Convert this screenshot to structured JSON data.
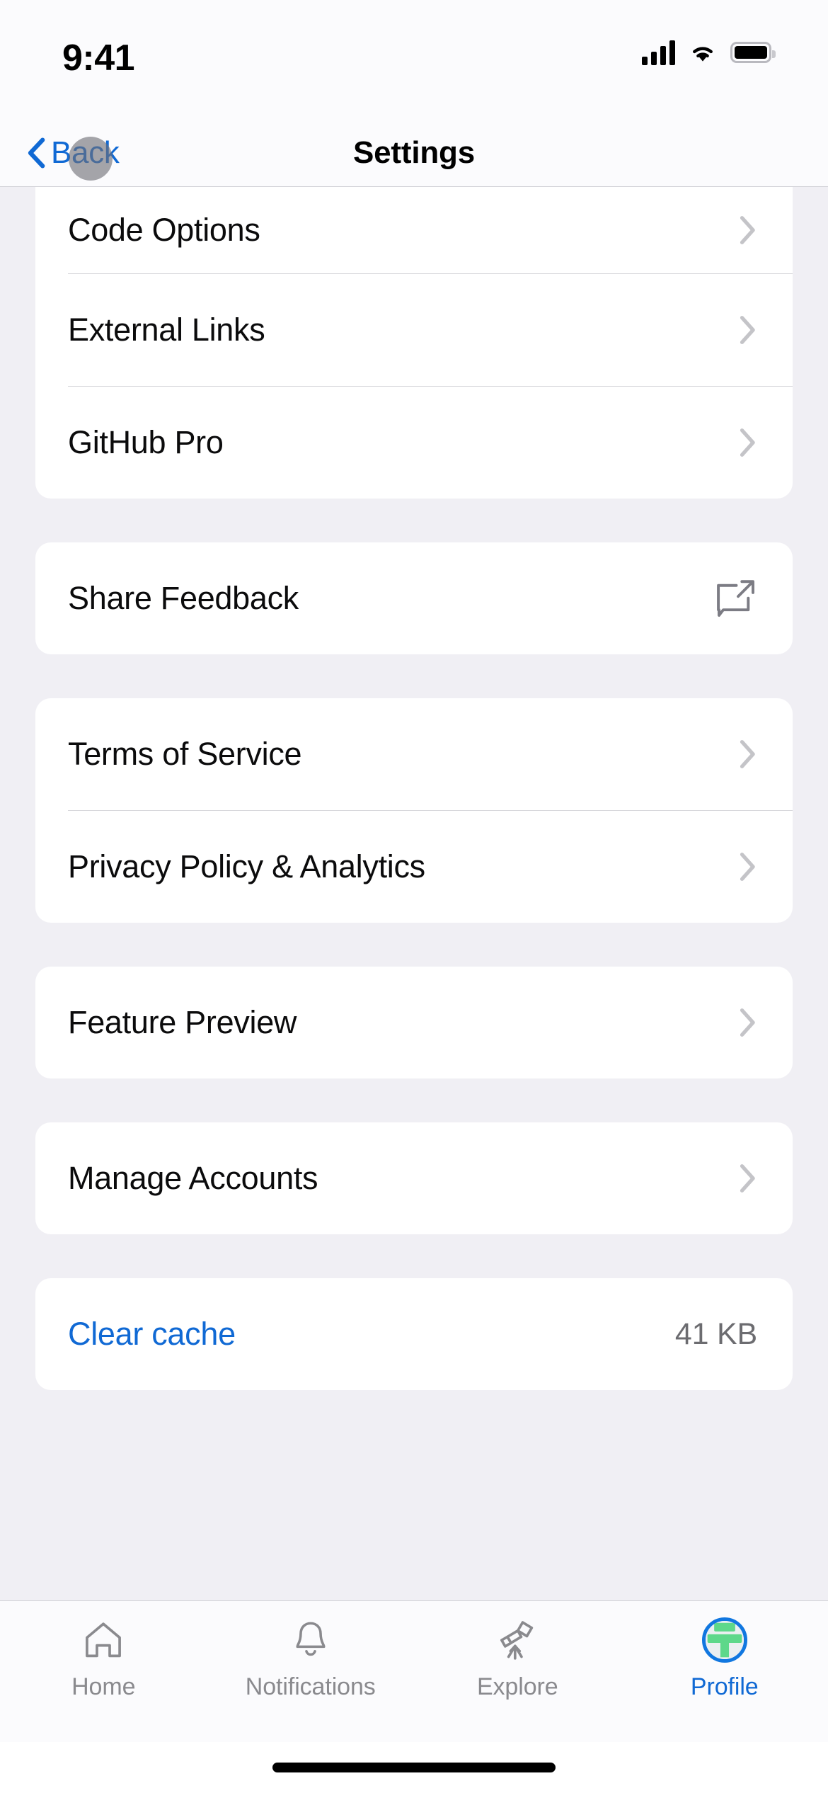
{
  "status_bar": {
    "time": "9:41",
    "cellular_icon": "cellular-signal-icon",
    "wifi_icon": "wifi-icon",
    "battery_icon": "battery-icon"
  },
  "nav": {
    "back_label": "Back",
    "back_icon": "chevron-left-icon",
    "title": "Settings"
  },
  "colors": {
    "accent_blue": "#1069d4",
    "background": "#f0eff4",
    "card": "#ffffff",
    "secondary_text": "#6c6c70",
    "separator": "#d6d6da",
    "avatar_green": "#5ed88a",
    "avatar_ring": "#1177e0"
  },
  "groups": [
    {
      "name": "developer-group",
      "clipped_top": true,
      "rows": [
        {
          "label": "Code Options",
          "accessory": "chevron-right-icon",
          "partial": true
        },
        {
          "label": "External Links",
          "accessory": "chevron-right-icon"
        },
        {
          "label": "GitHub Pro",
          "accessory": "chevron-right-icon"
        }
      ]
    },
    {
      "name": "feedback-group",
      "rows": [
        {
          "label": "Share Feedback",
          "accessory": "share-feedback-icon"
        }
      ]
    },
    {
      "name": "legal-group",
      "rows": [
        {
          "label": "Terms of Service",
          "accessory": "chevron-right-icon"
        },
        {
          "label": "Privacy Policy & Analytics",
          "accessory": "chevron-right-icon"
        }
      ]
    },
    {
      "name": "preview-group",
      "rows": [
        {
          "label": "Feature Preview",
          "accessory": "chevron-right-icon"
        }
      ]
    },
    {
      "name": "accounts-group",
      "rows": [
        {
          "label": "Manage Accounts",
          "accessory": "chevron-right-icon"
        }
      ]
    },
    {
      "name": "cache-group",
      "rows": [
        {
          "label": "Clear cache",
          "value": "41 KB",
          "link": true
        }
      ]
    }
  ],
  "tabs": [
    {
      "label": "Home",
      "icon": "home-icon",
      "active": false
    },
    {
      "label": "Notifications",
      "icon": "bell-icon",
      "active": false
    },
    {
      "label": "Explore",
      "icon": "telescope-icon",
      "active": false
    },
    {
      "label": "Profile",
      "icon": "avatar-icon",
      "active": true
    }
  ]
}
